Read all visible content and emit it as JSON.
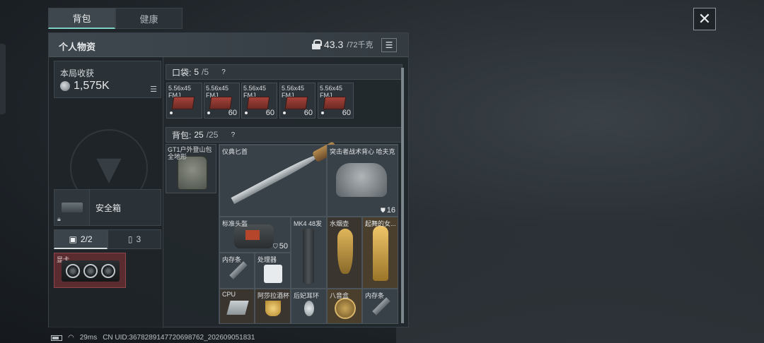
{
  "tabs": {
    "backpack": "背包",
    "health": "健康"
  },
  "close_glyph": "✕",
  "panel": {
    "title": "个人物资",
    "weight_current": "43.3",
    "weight_max": "/72千克",
    "list_glyph": "☰"
  },
  "income": {
    "label": "本局收获",
    "value": "1,575K",
    "menu_glyph": "☰"
  },
  "safe": {
    "label": "安全箱"
  },
  "container_tabs": [
    {
      "label": "2/2",
      "icon": "toolbox-icon"
    },
    {
      "label": "3",
      "icon": "battery-icon"
    }
  ],
  "gpu": {
    "label": "显卡"
  },
  "pocket": {
    "label": "口袋:",
    "count": "5",
    "total": "/5",
    "help": "?"
  },
  "pocket_items": [
    {
      "name": "5.56x45 FMJ",
      "qty": ""
    },
    {
      "name": "5.56x45 FMJ",
      "qty": "60"
    },
    {
      "name": "5.56x45 FMJ",
      "qty": "60"
    },
    {
      "name": "5.56x45 FMJ",
      "qty": "60"
    },
    {
      "name": "5.56x45 FMJ",
      "qty": "60"
    }
  ],
  "backpack": {
    "label": "背包:",
    "count": "25",
    "total": "/25",
    "help": "?"
  },
  "backpack_item": {
    "name": "GT1户外登山包 全地形"
  },
  "grid_items": [
    {
      "name": "仪典匕首",
      "qty": ""
    },
    {
      "name": "突击者战术背心 哈夫克",
      "qty": "16"
    },
    {
      "name": "标准头盔",
      "qty": "50"
    },
    {
      "name": "MK4 48发",
      "qty": ""
    },
    {
      "name": "水烟壶",
      "qty": ""
    },
    {
      "name": "起舞的女...",
      "qty": ""
    },
    {
      "name": "内存条",
      "qty": ""
    },
    {
      "name": "处理器",
      "qty": ""
    },
    {
      "name": "CPU",
      "qty": ""
    },
    {
      "name": "阿莎拉酒杯",
      "qty": ""
    },
    {
      "name": "后妃耳环",
      "qty": ""
    },
    {
      "name": "八音盒",
      "qty": ""
    },
    {
      "name": "内存条",
      "qty": ""
    }
  ],
  "status": {
    "ping": "29ms",
    "uid": "CN UID:3678289147720698762_202609051831"
  }
}
